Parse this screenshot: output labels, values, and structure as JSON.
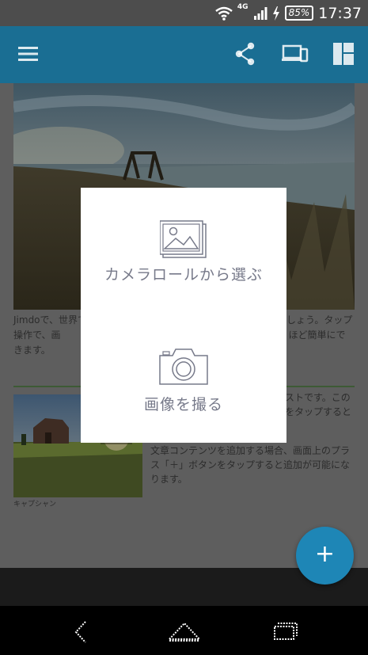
{
  "status_bar": {
    "network": "4G",
    "battery": "85%",
    "time": "17:37"
  },
  "app_bar": {
    "menu_icon": "hamburger-menu-icon",
    "share_icon": "share-icon",
    "devices_icon": "device-preview-icon",
    "layout_icon": "layout-icon"
  },
  "content": {
    "hero_image": "lakeside-sunset-photo",
    "text_block_1": "Jimdoで、世界で　　　　　　　　　　　　　　　　　　　　ましょう。タップ操作で、画　　　　　　　　　　　　　　　　　　　編集が驚くほど簡単にできます。",
    "thumb_image": "barn-field-photo",
    "caption": "キャプシャン",
    "text_block_2": "ストです。このをタップすると",
    "text_block_3": "文章コンテンツを追加する場合、画面上のプラス「＋」ボタンをタップすると追加が可能になります。"
  },
  "fab": {
    "label": "+"
  },
  "dialog": {
    "option1": {
      "icon": "image-gallery-icon",
      "label": "カメラロールから選ぶ"
    },
    "option2": {
      "icon": "camera-icon",
      "label": "画像を撮る"
    }
  },
  "nav_bar": {
    "back_icon": "back-icon",
    "home_icon": "home-icon",
    "recents_icon": "recent-apps-icon"
  },
  "colors": {
    "app_bar": "#1a6e93",
    "fab": "#1e86b6",
    "dialog_text": "#777a8a"
  }
}
